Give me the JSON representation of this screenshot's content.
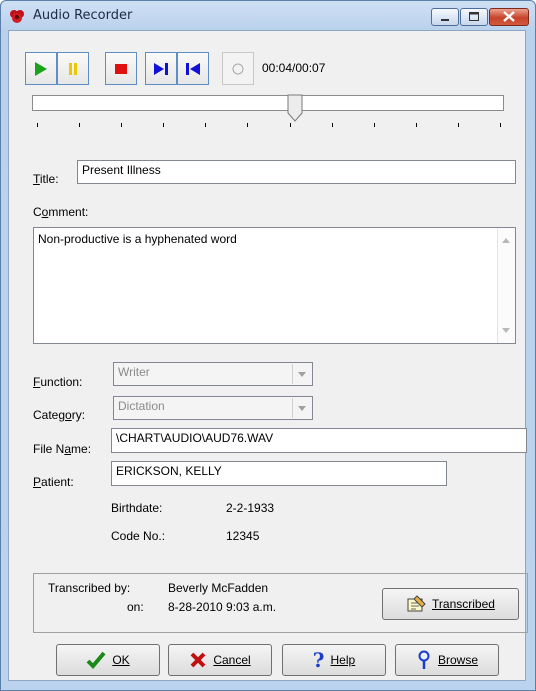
{
  "window": {
    "title": "Audio Recorder"
  },
  "toolbar": {
    "time_display": "00:04/00:07"
  },
  "slider": {
    "position_fraction": 0.56
  },
  "form": {
    "title_label": "Title:",
    "title_value": "Present Illness",
    "comment_label": "Comment:",
    "comment_value": "Non-productive is a hyphenated word",
    "function_label": "Function:",
    "function_value": "Writer",
    "category_label": "Category:",
    "category_value": "Dictation",
    "filename_label": "File Name:",
    "filename_value": "\\CHART\\AUDIO\\AUD76.WAV",
    "patient_label": "Patient:",
    "patient_value": "ERICKSON, KELLY",
    "birthdate_label": "Birthdate:",
    "birthdate_value": "2-2-1933",
    "code_label": "Code No.:",
    "code_value": "12345"
  },
  "transcription": {
    "by_label": "Transcribed by:",
    "by_value": "Beverly McFadden",
    "on_label": "on:",
    "on_value": "8-28-2010 9:03 a.m.",
    "button_label": "Transcribed"
  },
  "buttons": {
    "ok": "OK",
    "cancel": "Cancel",
    "help": "Help",
    "browse": "Browse"
  },
  "colors": {
    "play": "#1aa31a",
    "pause": "#e8c800",
    "stop": "#e01010",
    "nav": "#1010d8"
  }
}
